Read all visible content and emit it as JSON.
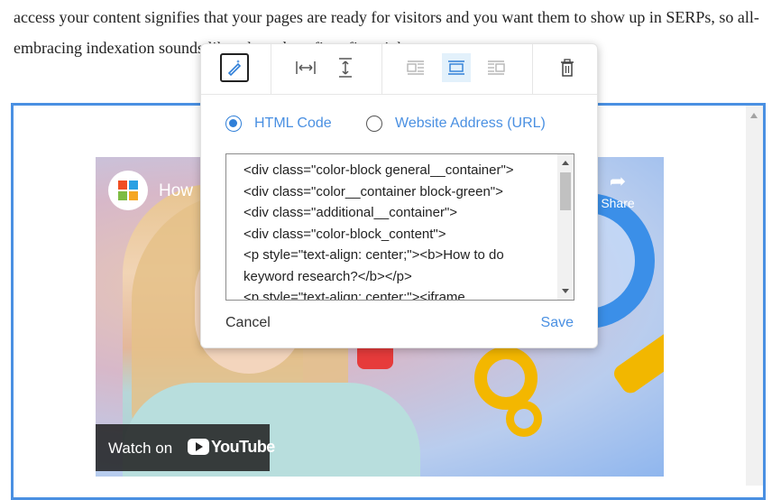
{
  "article": {
    "text": "access your content signifies that your pages are ready for visitors and you want them to show up in SERPs, so all-embracing indexation sounds like a huge benefit at first sight."
  },
  "video": {
    "title": "How",
    "share_label": "Share",
    "watch_label": "Watch on",
    "youtube_word": "YouTube"
  },
  "toolbar": {
    "icons": [
      "edit-magic-icon",
      "width-icon",
      "height-icon",
      "align-left-icon",
      "align-center-icon",
      "align-right-icon",
      "trash-icon"
    ],
    "active": "align-center-icon"
  },
  "embed_dialog": {
    "options": [
      {
        "label": "HTML Code",
        "checked": true
      },
      {
        "label": "Website Address (URL)",
        "checked": false
      }
    ],
    "code_lines": [
      "<div class=\"color-block general__container\">",
      "<div class=\"color__container block-green\">",
      "<div class=\"additional__container\">",
      "<div class=\"color-block_content\">",
      "<p style=\"text-align: center;\"><b>How to do",
      "keyword research?</b></p>",
      "<p style=\"text-align: center;\"><iframe"
    ],
    "cancel_label": "Cancel",
    "save_label": "Save"
  },
  "colors": {
    "accent": "#4a90e2",
    "frame_border": "#4a90e2",
    "active_tool_bg": "#e3f1fb"
  }
}
